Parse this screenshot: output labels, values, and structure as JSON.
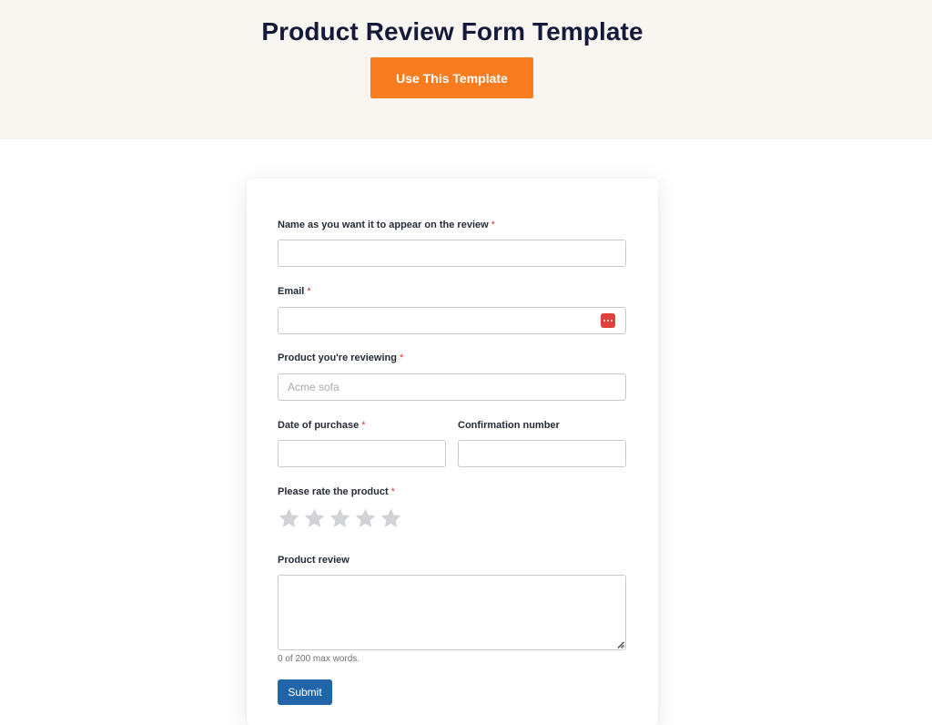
{
  "hero": {
    "title": "Product Review Form Template",
    "cta_label": "Use This Template"
  },
  "colors": {
    "hero_bg": "#f9f5f0",
    "cta_bg": "#f97c21",
    "submit_bg": "#1f65a8",
    "required": "#d63637",
    "star_empty": "#d0d2d6"
  },
  "form": {
    "name": {
      "label": "Name as you want it to appear on the review",
      "required_mark": "*",
      "value": "",
      "placeholder": ""
    },
    "email": {
      "label": "Email",
      "required_mark": "*",
      "value": "",
      "placeholder": "",
      "badge_icon": "password-manager-icon"
    },
    "product": {
      "label": "Product you're reviewing",
      "required_mark": "*",
      "value": "",
      "placeholder": "Acme sofa"
    },
    "date": {
      "label": "Date of purchase",
      "required_mark": "*",
      "value": "",
      "placeholder": ""
    },
    "confirmation": {
      "label": "Confirmation number",
      "value": "",
      "placeholder": ""
    },
    "rating": {
      "label": "Please rate the product",
      "required_mark": "*",
      "max": 5,
      "value": 0,
      "icon": "star-icon"
    },
    "review": {
      "label": "Product review",
      "value": "",
      "placeholder": "",
      "hint": "0 of 200 max words."
    },
    "submit_label": "Submit"
  }
}
